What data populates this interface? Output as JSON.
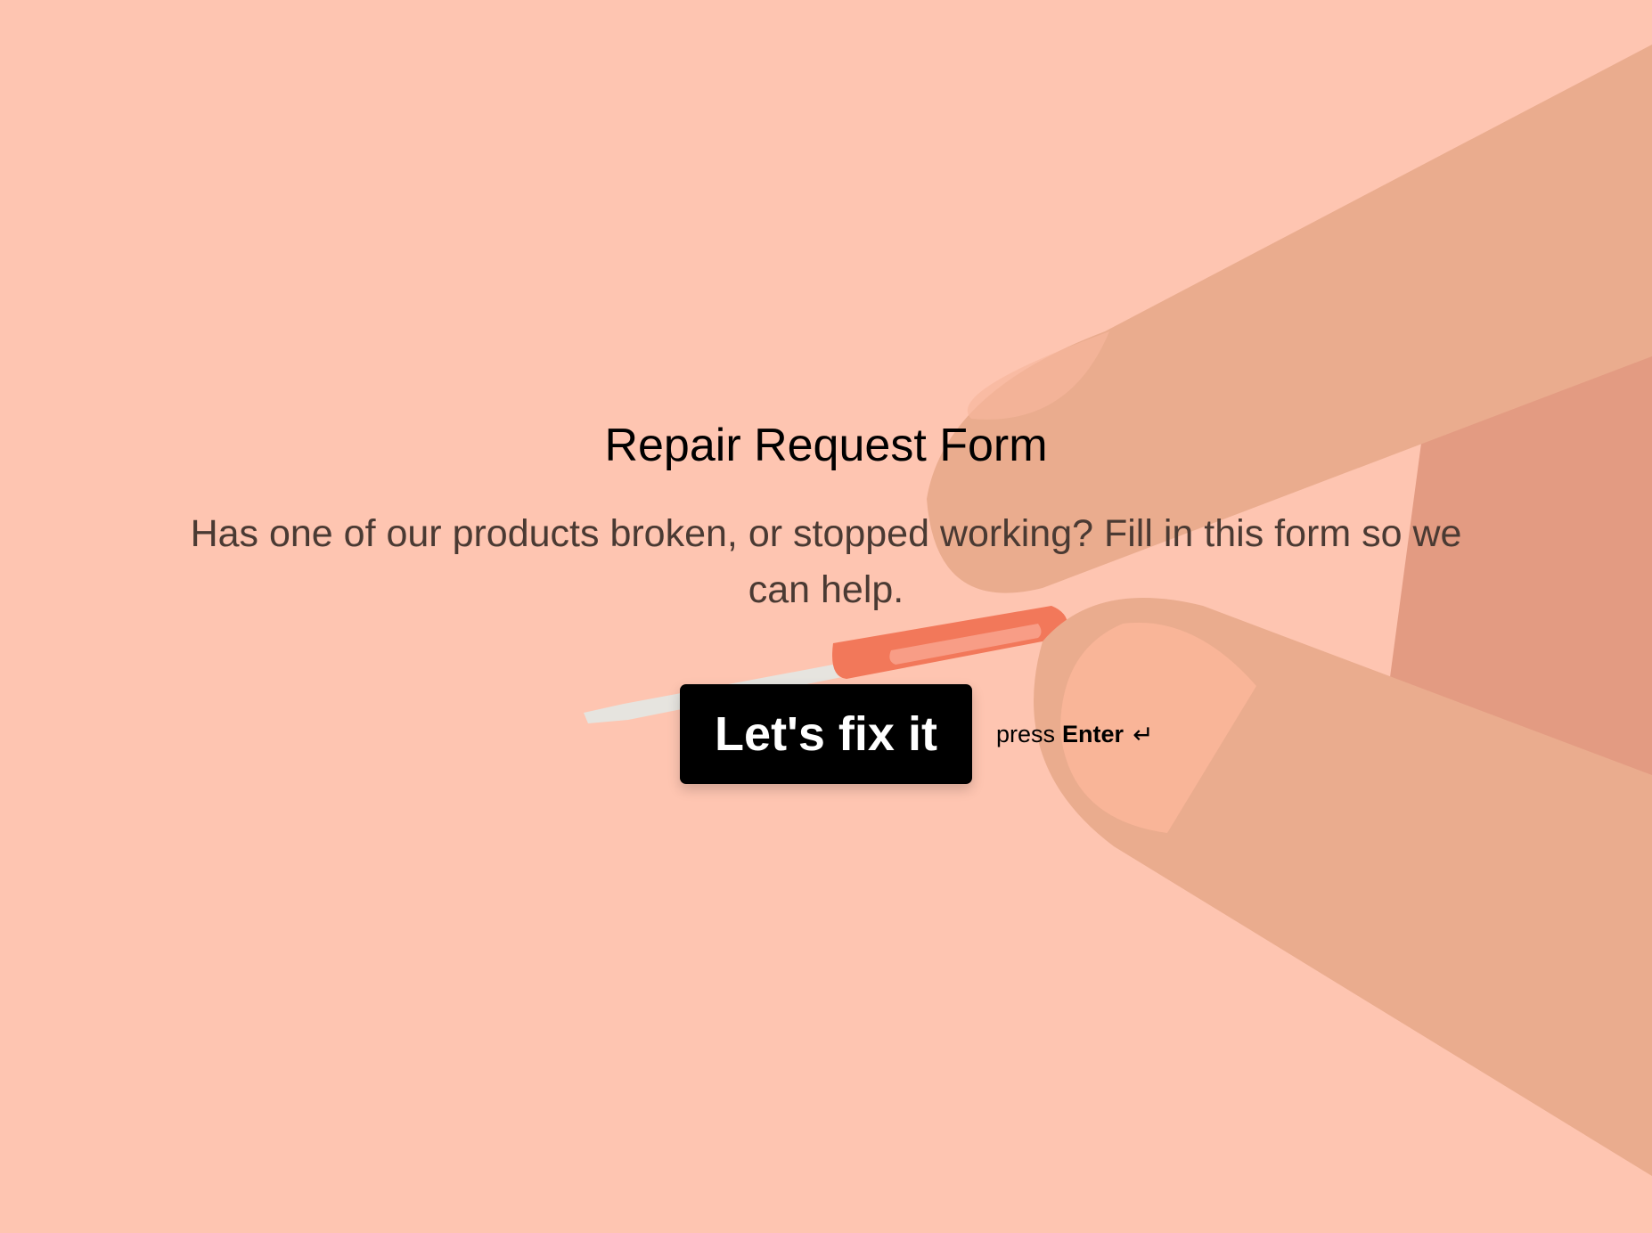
{
  "form": {
    "title": "Repair Request Form",
    "description": "Has one of our products broken, or stopped working? Fill in this form so we can help.",
    "start_button_label": "Let's fix it",
    "hint_prefix": "press",
    "hint_key": "Enter",
    "hint_icon_glyph": "↵"
  },
  "theme": {
    "background": "#fec5b1",
    "button_bg": "#000000",
    "button_text": "#ffffff",
    "title_color": "#000000",
    "description_color": "#4a3a33"
  },
  "icons": {
    "enter": "enter-key-icon",
    "illustration": "hand-holding-screwdriver"
  }
}
